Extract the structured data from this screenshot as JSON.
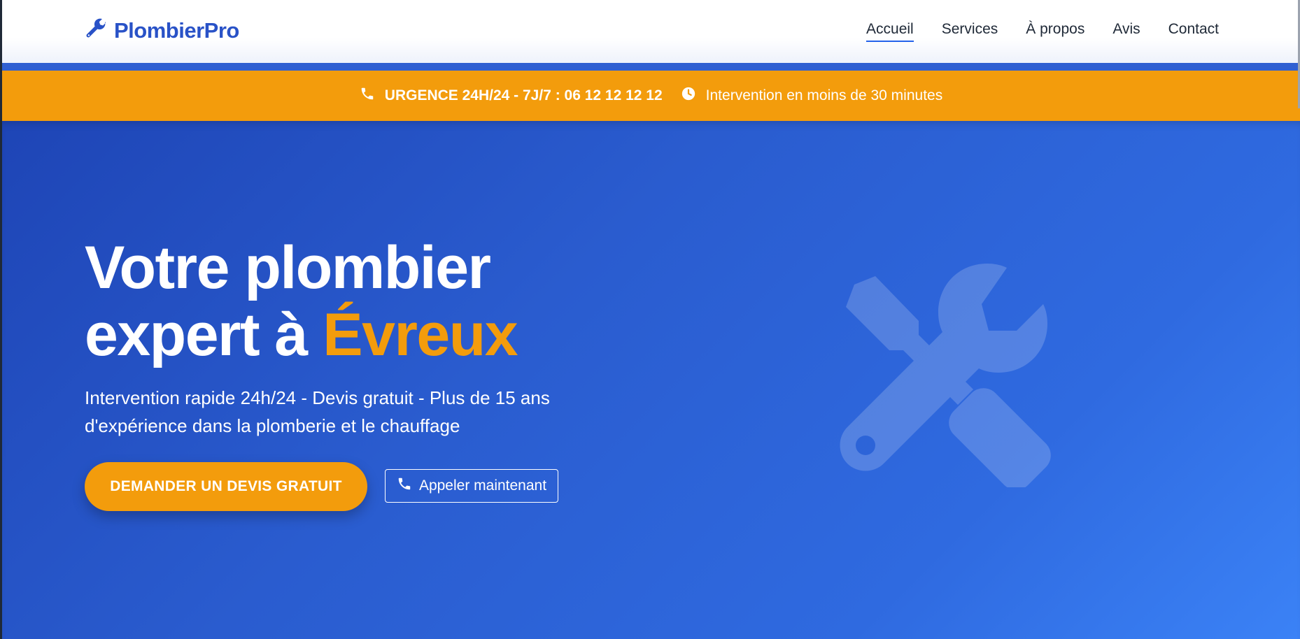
{
  "header": {
    "logo_text": "PlombierPro",
    "logo_icon": "wrench-icon",
    "nav": [
      {
        "label": "Accueil",
        "active": true
      },
      {
        "label": "Services",
        "active": false
      },
      {
        "label": "À propos",
        "active": false
      },
      {
        "label": "Avis",
        "active": false
      },
      {
        "label": "Contact",
        "active": false
      }
    ]
  },
  "urgent_bar": {
    "phone_text": "URGENCE 24H/24 - 7J/7 : 06 12 12 12 12",
    "time_text": "Intervention en moins de 30 minutes",
    "phone_icon": "phone-icon",
    "time_icon": "clock-icon"
  },
  "hero": {
    "title_line1": "Votre plombier",
    "title_line2_prefix": "expert à ",
    "title_accent": "Évreux",
    "subtitle": "Intervention rapide 24h/24 - Devis gratuit - Plus de 15 ans d'expérience dans la plomberie et le chauffage",
    "cta_primary": "DEMANDER UN DEVIS GRATUIT",
    "cta_secondary": "Appeler maintenant",
    "illustration_icon": "screwdriver-wrench-icon"
  },
  "colors": {
    "brand_blue": "#2952c7",
    "accent_orange": "#f39c0c",
    "hero_gradient_start": "#1e45b6",
    "hero_gradient_end": "#3b82f6"
  }
}
